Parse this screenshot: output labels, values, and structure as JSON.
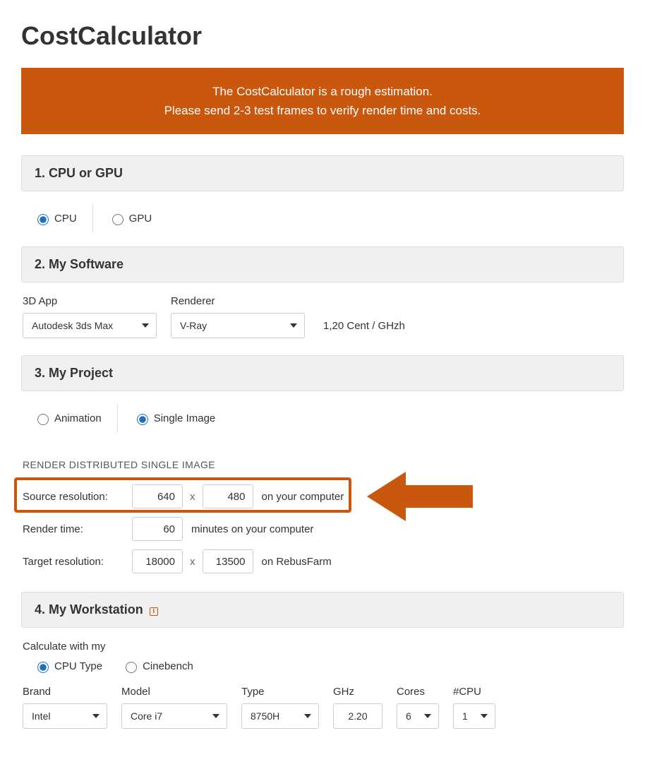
{
  "title": "CostCalculator",
  "banner": {
    "line1": "The CostCalculator is a rough estimation.",
    "line2": "Please send 2-3 test frames to verify render time and costs."
  },
  "section1": {
    "header": "1. CPU or GPU",
    "options": {
      "cpu": "CPU",
      "gpu": "GPU"
    },
    "selected": "cpu"
  },
  "section2": {
    "header": "2. My Software",
    "app_label": "3D App",
    "app_value": "Autodesk 3ds Max",
    "renderer_label": "Renderer",
    "renderer_value": "V-Ray",
    "price": "1,20 Cent / GHzh"
  },
  "section3": {
    "header": "3. My Project",
    "options": {
      "animation": "Animation",
      "single": "Single Image"
    },
    "selected": "single",
    "subheading": "RENDER DISTRIBUTED SINGLE IMAGE",
    "source_label": "Source resolution:",
    "source_w": "640",
    "source_h": "480",
    "source_suffix": "on your computer",
    "rendertime_label": "Render time:",
    "rendertime_value": "60",
    "rendertime_suffix": "minutes on your computer",
    "target_label": "Target resolution:",
    "target_w": "18000",
    "target_h": "13500",
    "target_suffix": "on RebusFarm"
  },
  "section4": {
    "header": "4. My Workstation",
    "calc_with_label": "Calculate with my",
    "options": {
      "cputype": "CPU Type",
      "cinebench": "Cinebench"
    },
    "selected": "cputype",
    "brand_label": "Brand",
    "brand_value": "Intel",
    "model_label": "Model",
    "model_value": "Core i7",
    "type_label": "Type",
    "type_value": "8750H",
    "ghz_label": "GHz",
    "ghz_value": "2.20",
    "cores_label": "Cores",
    "cores_value": "6",
    "ncpu_label": "#CPU",
    "ncpu_value": "1"
  }
}
